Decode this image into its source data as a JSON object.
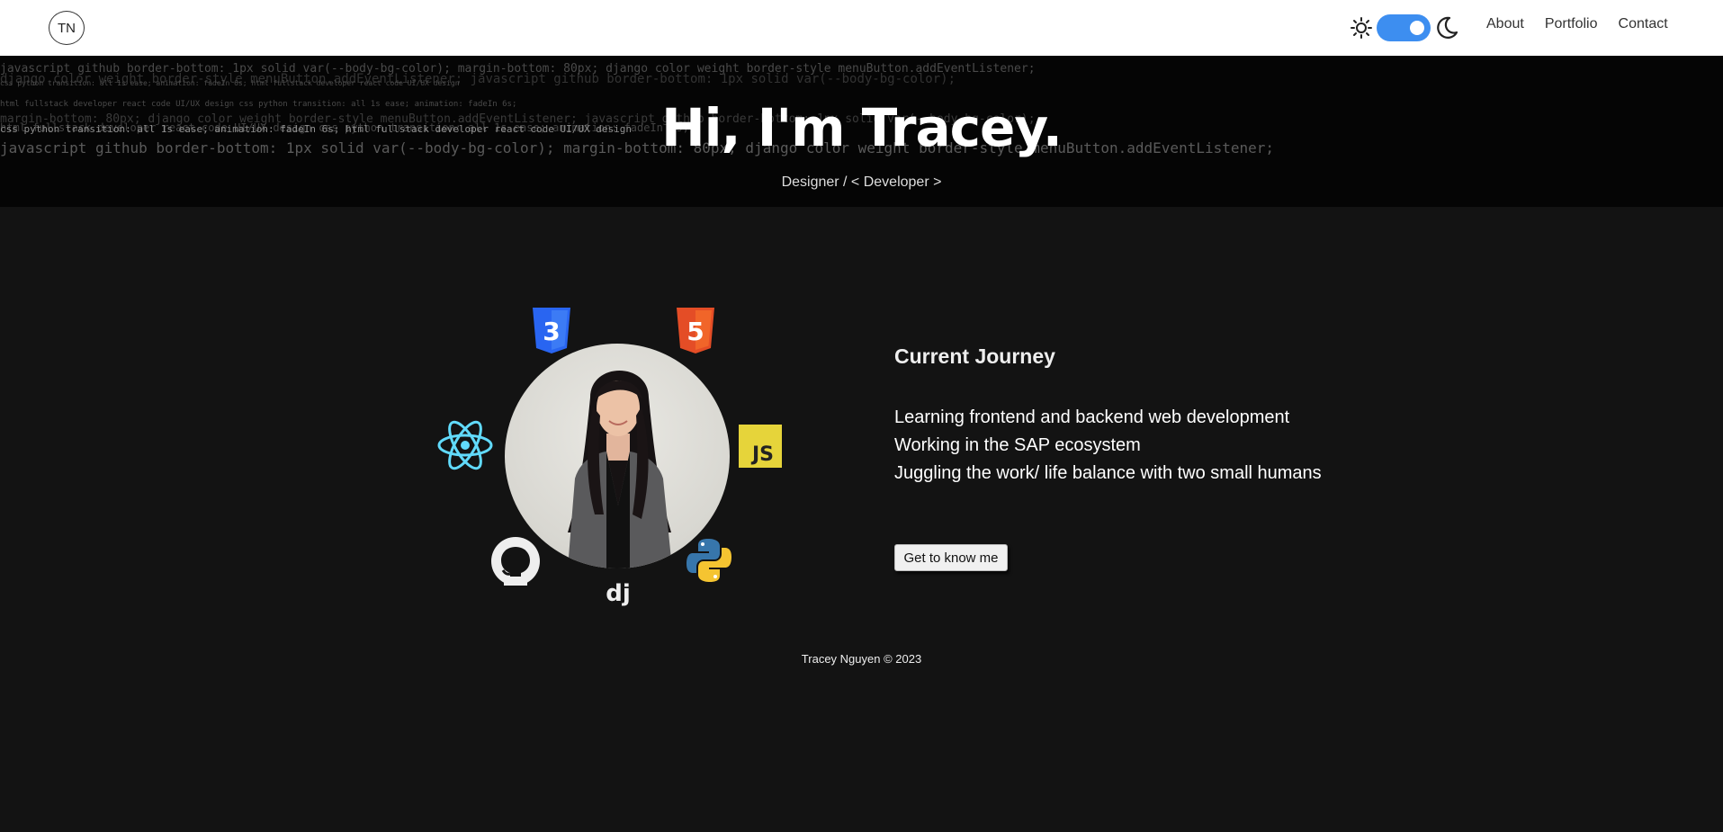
{
  "nav": {
    "logo": "TN",
    "items": [
      {
        "label": "About"
      },
      {
        "label": "Portfolio"
      },
      {
        "label": "Contact"
      }
    ],
    "theme_toggle": {
      "state": "on",
      "accent": "#3d8ef0"
    }
  },
  "hero": {
    "title": "Hi, I'm Tracey.",
    "subtitle": "Designer / < Developer >",
    "code_lines": [
      "javascript github border-bottom: 1px solid var(--body-bg-color); margin-bottom: 80px; django color weight border-style menuButton.addEventListener;",
      "django color weight border-style menuButton.addEventListener; javascript github border-bottom: 1px solid var(--body-bg-color);",
      "css python transition: all 1s ease; animation: fadeIn 6s; html fullstack developer react code UI/UX design",
      "html fullstack developer react code UI/UX design css python transition: all 1s ease; animation: fadeIn 6s;",
      "margin-bottom: 80px; django color weight border-style menuButton.addEventListener; javascript github border-bottom: 1px solid var(--body-bg-color);",
      "html fullstack developer react code UI/UX design css python transition: all 1s ease; animation: fadeIn 6s;",
      "css python transition: all 1s ease; animation: fadeIn 6s; html fullstack developer react code UI/UX design",
      "javascript github border-bottom: 1px solid var(--body-bg-color); margin-bottom: 80px; django color weight border-style menuButton.addEventListener;"
    ]
  },
  "skills": {
    "icons": [
      {
        "name": "css3-icon",
        "label": "3"
      },
      {
        "name": "html5-icon",
        "label": "5"
      },
      {
        "name": "react-icon"
      },
      {
        "name": "javascript-icon",
        "label": "JS"
      },
      {
        "name": "github-icon"
      },
      {
        "name": "python-icon"
      },
      {
        "name": "django-icon",
        "label": "dj"
      }
    ],
    "colors": {
      "css": "#2965f1",
      "html": "#e44d26",
      "react": "#61dafb",
      "js": "#e6d43a",
      "python_blue": "#3776ab",
      "python_yellow": "#f5c431"
    }
  },
  "journey": {
    "heading": "Current Journey",
    "items": [
      "Learning frontend and backend web development",
      "Working in the SAP ecosystem",
      "Juggling the work/ life balance with two small humans"
    ],
    "button_label": "Get to know me"
  },
  "footer": {
    "text": "Tracey Nguyen © 2023"
  }
}
